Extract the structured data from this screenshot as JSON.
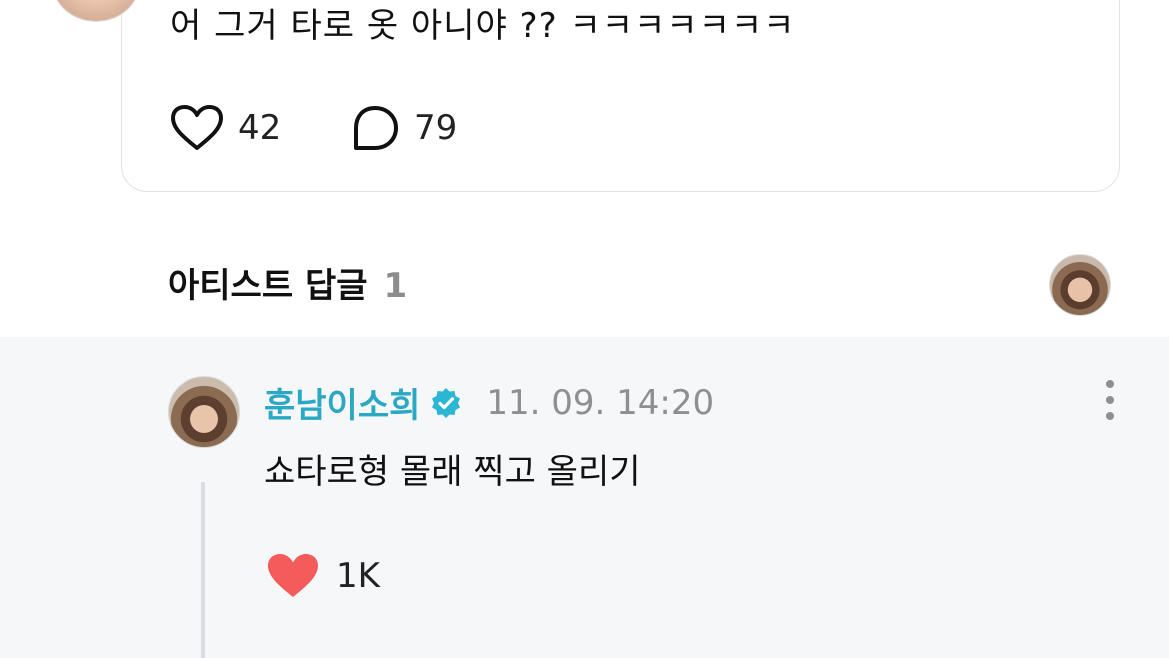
{
  "post": {
    "text": "어 그거 타로 옷 아니야 ?? ㅋㅋㅋㅋㅋㅋㅋ",
    "likes": "42",
    "comments": "79"
  },
  "artist_replies": {
    "title": "아티스트 답글",
    "count": "1"
  },
  "reply": {
    "author": "훈남이소희",
    "verified_icon": "verified-check-icon",
    "timestamp": "11. 09. 14:20",
    "text": "쇼타로형 몰래 찍고 올리기",
    "likes": "1K"
  },
  "colors": {
    "author": "#2aa8c4",
    "verified": "#2bb6d6",
    "liked_heart": "#f45b5b",
    "reply_background": "#f6f7f9"
  }
}
